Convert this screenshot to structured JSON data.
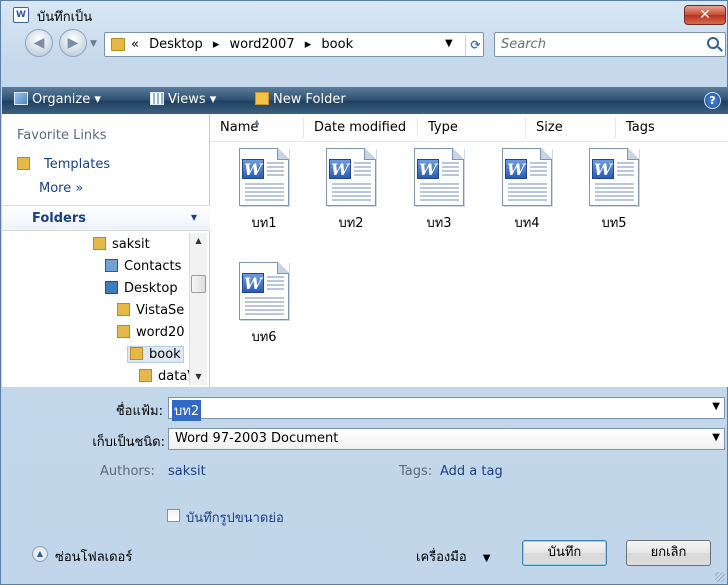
{
  "window": {
    "title": "บันทึกเป็น",
    "app_icon": "word-doc-icon",
    "close_label": "✕"
  },
  "address_bar": {
    "crumbs": [
      "«",
      "Desktop",
      "▸",
      "word2007",
      "▸",
      "book"
    ],
    "search_placeholder": "Search"
  },
  "toolbar": {
    "organize": "Organize ▾",
    "views": "Views ▾",
    "new_folder": "New Folder",
    "help": "?"
  },
  "nav_pane": {
    "favorite_links_heading": "Favorite Links",
    "favorite_links": [
      "Templates"
    ],
    "more_label": "More »",
    "folders_heading": "Folders",
    "tree": [
      {
        "label": "saksit",
        "icon": "folder"
      },
      {
        "label": "Contacts",
        "icon": "contacts"
      },
      {
        "label": "Desktop",
        "icon": "desktop"
      },
      {
        "label": "VistaSe",
        "icon": "folder"
      },
      {
        "label": "word20",
        "icon": "folder"
      },
      {
        "label": "book",
        "icon": "folder",
        "selected": true
      },
      {
        "label": "dataV",
        "icon": "folder"
      }
    ]
  },
  "file_pane": {
    "columns": [
      "Name",
      "Date modified",
      "Type",
      "Size",
      "Tags"
    ],
    "files": [
      "บท1",
      "บท2",
      "บท3",
      "บท4",
      "บท5",
      "บท6"
    ]
  },
  "form": {
    "filename_label": "ชื่อแฟ้ม:",
    "filename_value": "บท2",
    "savetype_label": "เก็บเป็นชนิด:",
    "savetype_value": "Word 97-2003 Document",
    "authors_label": "Authors:",
    "authors_value": "saksit",
    "tags_label": "Tags:",
    "tags_value": "Add a tag",
    "thumbnail_label": "บันทึกรูปขนาดย่อ",
    "thumbnail_checked": false
  },
  "footer": {
    "hide_folders": "ซ่อนโฟลเดอร์",
    "tools": "เครื่องมือ",
    "save": "บันทึก",
    "cancel": "ยกเลิก"
  }
}
